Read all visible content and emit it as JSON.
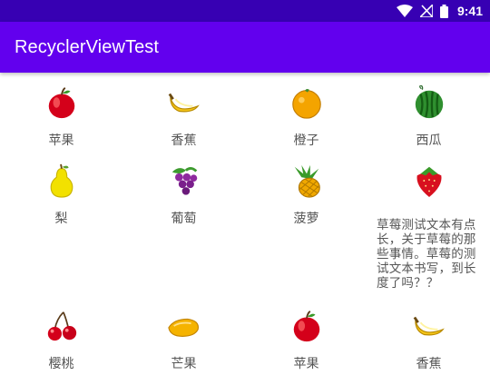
{
  "status_bar": {
    "time": "9:41"
  },
  "app_bar": {
    "title": "RecyclerViewTest"
  },
  "fruits": [
    {
      "name": "苹果",
      "icon": "apple-icon"
    },
    {
      "name": "香蕉",
      "icon": "banana-icon"
    },
    {
      "name": "橙子",
      "icon": "orange-icon"
    },
    {
      "name": "西瓜",
      "icon": "watermelon-icon"
    },
    {
      "name": "梨",
      "icon": "pear-icon"
    },
    {
      "name": "葡萄",
      "icon": "grape-icon"
    },
    {
      "name": "菠萝",
      "icon": "pineapple-icon"
    },
    {
      "name": "草莓测试文本有点长，关于草莓的那些事情。草莓的测试文本书写，到长度了吗？？",
      "icon": "strawberry-icon"
    },
    {
      "name": "樱桃",
      "icon": "cherry-icon"
    },
    {
      "name": "芒果",
      "icon": "mango-icon"
    },
    {
      "name": "苹果",
      "icon": "apple-icon"
    },
    {
      "name": "香蕉",
      "icon": "banana-icon"
    }
  ],
  "colors": {
    "status_bar": "#3700b3",
    "app_bar": "#6200ee"
  }
}
